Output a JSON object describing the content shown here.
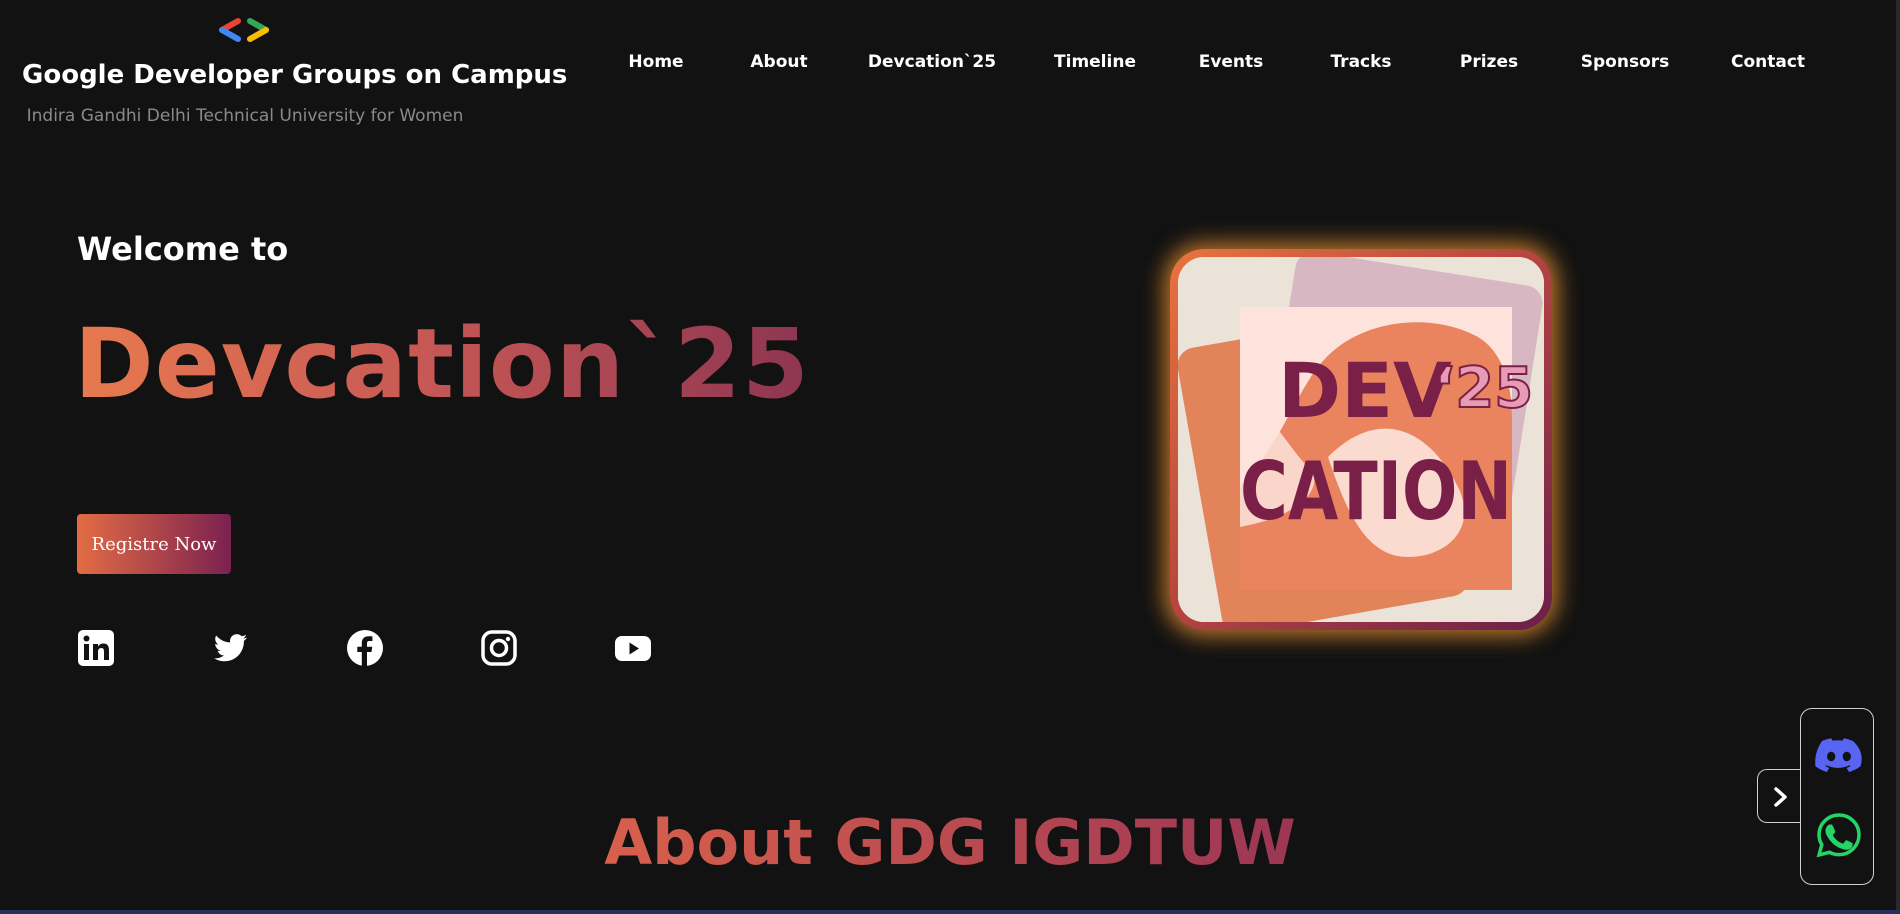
{
  "brand": {
    "title": "Google Developer Groups on Campus",
    "subtitle": "Indira Gandhi Delhi Technical University for Women",
    "logo_icon": "gdg-brackets-logo"
  },
  "nav": {
    "items": [
      {
        "label": "Home"
      },
      {
        "label": "About"
      },
      {
        "label": "Devcation`25"
      },
      {
        "label": "Timeline"
      },
      {
        "label": "Events"
      },
      {
        "label": "Tracks"
      },
      {
        "label": "Prizes"
      },
      {
        "label": "Sponsors"
      },
      {
        "label": "Contact"
      }
    ]
  },
  "hero": {
    "welcome": "Welcome to",
    "title": "Devcation`25",
    "register_label": "Registre Now",
    "image": {
      "line1": "DEV",
      "year": "‘25",
      "line2": "CATION"
    }
  },
  "social": [
    {
      "icon": "linkedin-icon"
    },
    {
      "icon": "twitter-icon"
    },
    {
      "icon": "facebook-icon"
    },
    {
      "icon": "instagram-icon"
    },
    {
      "icon": "youtube-icon"
    }
  ],
  "about": {
    "title": "About GDG IGDTUW"
  },
  "floating": {
    "icons": [
      "discord-icon",
      "whatsapp-icon",
      "chevron-right-icon"
    ]
  },
  "colors": {
    "background": "#121212",
    "accent_orange": "#e87a4f",
    "accent_plum": "#7a2150",
    "discord": "#5865f2",
    "whatsapp": "#25d366"
  }
}
